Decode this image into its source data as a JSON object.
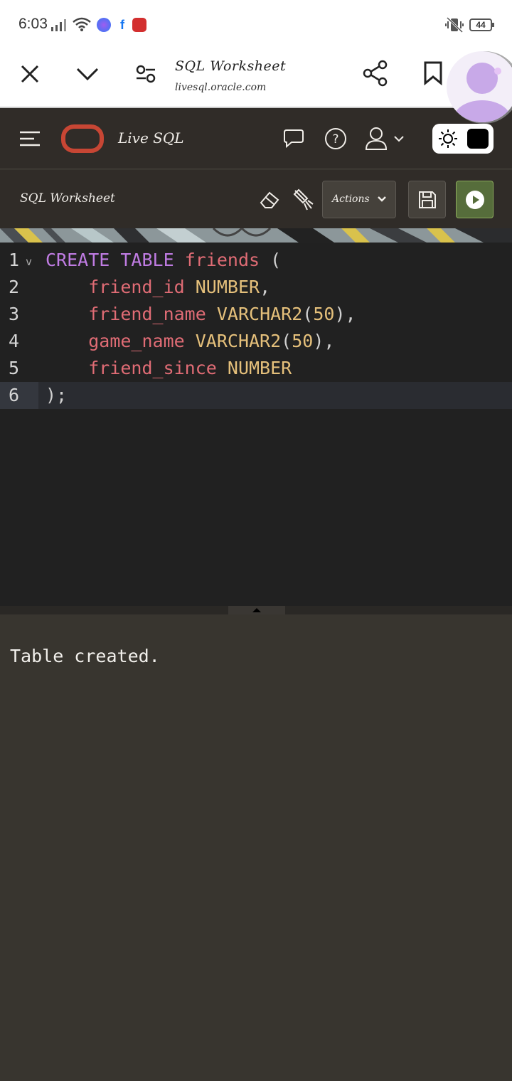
{
  "status_bar": {
    "time": "6:03",
    "battery": "44"
  },
  "browser": {
    "page_title": "SQL Worksheet",
    "url": "livesql.oracle.com"
  },
  "app_header": {
    "brand": "Live SQL"
  },
  "toolbar": {
    "title": "SQL Worksheet",
    "actions_label": "Actions"
  },
  "editor": {
    "lines": [
      {
        "num": "1",
        "tokens": [
          [
            "kw",
            "CREATE"
          ],
          [
            "sp",
            " "
          ],
          [
            "kw",
            "TABLE"
          ],
          [
            "sp",
            " "
          ],
          [
            "id",
            "friends"
          ],
          [
            "sp",
            " "
          ],
          [
            "pn",
            "("
          ]
        ]
      },
      {
        "num": "2",
        "tokens": [
          [
            "sp",
            "    "
          ],
          [
            "id",
            "friend_id"
          ],
          [
            "sp",
            " "
          ],
          [
            "ty",
            "NUMBER"
          ],
          [
            "pn",
            ","
          ]
        ]
      },
      {
        "num": "3",
        "tokens": [
          [
            "sp",
            "    "
          ],
          [
            "id",
            "friend_name"
          ],
          [
            "sp",
            " "
          ],
          [
            "ty",
            "VARCHAR2"
          ],
          [
            "pn",
            "("
          ],
          [
            "ty",
            "50"
          ],
          [
            "pn",
            "),"
          ]
        ]
      },
      {
        "num": "4",
        "tokens": [
          [
            "sp",
            "    "
          ],
          [
            "id",
            "game_name"
          ],
          [
            "sp",
            " "
          ],
          [
            "ty",
            "VARCHAR2"
          ],
          [
            "pn",
            "("
          ],
          [
            "ty",
            "50"
          ],
          [
            "pn",
            "),"
          ]
        ]
      },
      {
        "num": "5",
        "tokens": [
          [
            "sp",
            "    "
          ],
          [
            "id",
            "friend_since"
          ],
          [
            "sp",
            " "
          ],
          [
            "ty",
            "NUMBER"
          ]
        ]
      },
      {
        "num": "6",
        "tokens": [
          [
            "pn",
            ");"
          ]
        ]
      }
    ]
  },
  "output": {
    "message": "Table created."
  },
  "colors": {
    "accent_oracle": "#c74634",
    "run_button": "#566d3b",
    "keyword": "#c07ce3",
    "identifier": "#e06c75",
    "type": "#e5c07b"
  }
}
